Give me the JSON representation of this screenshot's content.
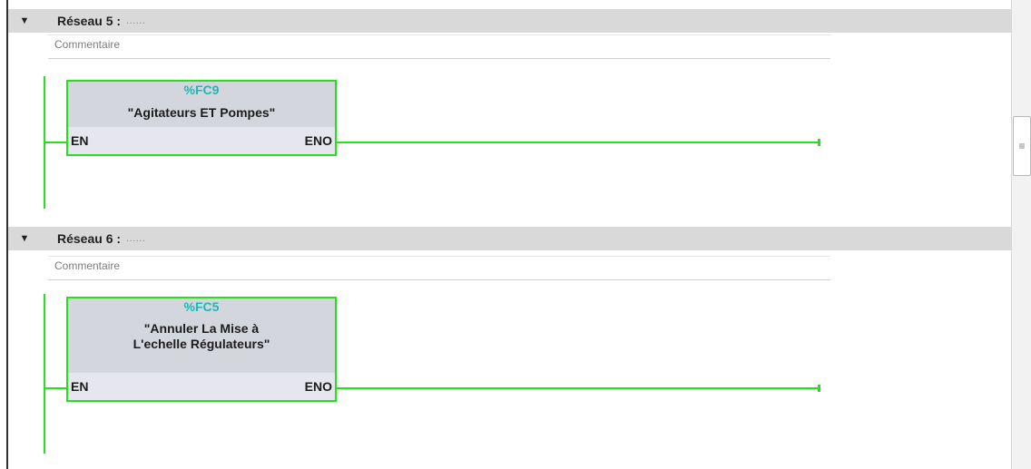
{
  "networks": [
    {
      "title": "Réseau 5 :",
      "dots": "......",
      "comment": "Commentaire",
      "block": {
        "address": "%FC9",
        "name": "\"Agitateurs ET Pompes\"",
        "name_line2": "",
        "in_pin": "EN",
        "out_pin": "ENO"
      }
    },
    {
      "title": "Réseau 6 :",
      "dots": "......",
      "comment": "Commentaire",
      "block": {
        "address": "%FC5",
        "name": "\"Annuler La Mise à",
        "name_line2": "L'echelle Régulateurs\"",
        "in_pin": "EN",
        "out_pin": "ENO"
      }
    }
  ],
  "icons": {
    "collapse": "triangle-down-icon",
    "scroll_grip": "grip-lines-icon"
  },
  "colors": {
    "wire": "#26e01f",
    "address": "#1db7b5",
    "header_bg": "#d9d9d9",
    "block_bg": "#d4d6de"
  }
}
